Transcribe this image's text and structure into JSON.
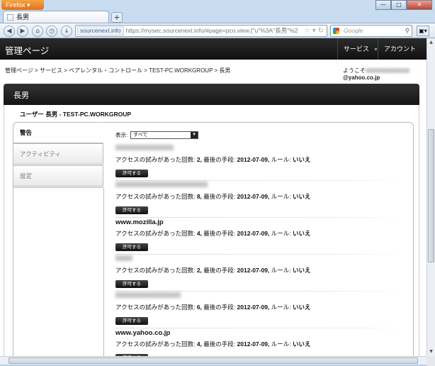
{
  "browser": {
    "app_button": "Firefox",
    "tab_title": "長男",
    "new_tab": "+",
    "url_site": "sourcenext.info",
    "url": "https://mysec.sourcenext.info/#page=pco.view.{\"u\"%3A\"長男\"%2",
    "search_placeholder": "Google",
    "window_controls": {
      "minimize": "—",
      "maximize": "□",
      "close": "✕"
    }
  },
  "header": {
    "brand": "管理ページ",
    "menus": [
      {
        "label": "サービス"
      },
      {
        "label": "アカウント"
      }
    ]
  },
  "breadcrumb": {
    "path": "管理ページ > サービス > ペアレンタル・コントロール > TEST-PC.WORKGROUP > 長男"
  },
  "welcome": {
    "prefix": "ようこそ",
    "email_domain": "@yahoo.co.jp"
  },
  "card": {
    "title": "長男",
    "user_title": "ユーザー 長男 - TEST-PC.WORKGROUP"
  },
  "side_tabs": [
    {
      "label": "警告"
    },
    {
      "label": "アクティビティ"
    },
    {
      "label": "設定"
    }
  ],
  "filter": {
    "label": "表示:",
    "value": "すべて"
  },
  "entry_labels": {
    "attempts": "アクセスの試みがあった回数:",
    "last_method": "最後の手段:",
    "rule": "ルール:",
    "allow_button": "許可する"
  },
  "entries": [
    {
      "name": "",
      "attempts": "2,",
      "date": "2012-07-09,",
      "rule": "いいえ"
    },
    {
      "name": "",
      "attempts": "8,",
      "date": "2012-07-09,",
      "rule": "いいえ"
    },
    {
      "name": "www.mozilla.jp",
      "attempts": "4,",
      "date": "2012-07-09,",
      "rule": "いいえ"
    },
    {
      "name": "",
      "attempts": "2,",
      "date": "2012-07-09,",
      "rule": "いいえ"
    },
    {
      "name": "",
      "attempts": "6,",
      "date": "2012-07-09,",
      "rule": "いいえ"
    },
    {
      "name": "www.yahoo.co.jp",
      "attempts": "4,",
      "date": "2012-07-09,",
      "rule": "いいえ"
    }
  ]
}
